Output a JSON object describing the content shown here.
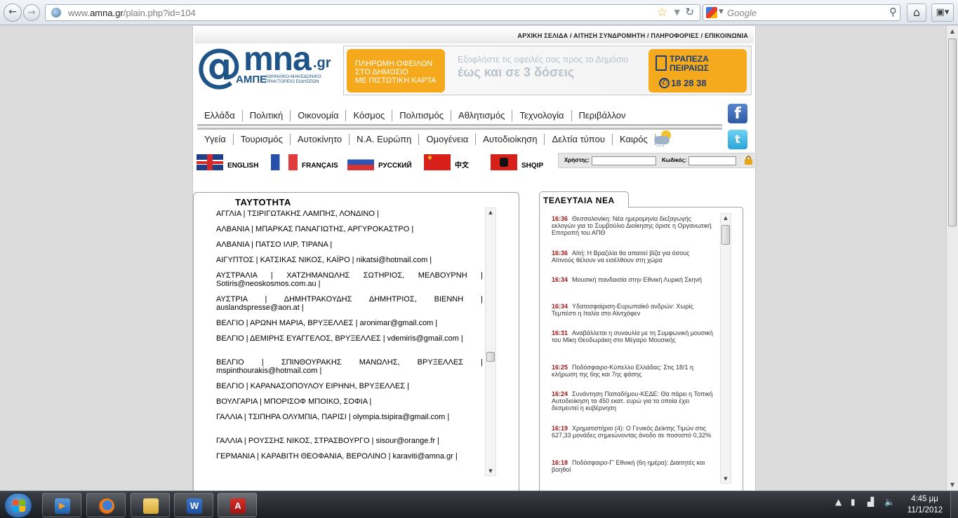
{
  "browser": {
    "url_prefix": "www.",
    "url_domain": "amna.gr",
    "url_path": "/plain.php?id=104",
    "search_placeholder": "Google"
  },
  "site": {
    "top_links": "ΑΡΧΙΚΗ ΣΕΛΙΔΑ / ΑΙΤΗΣΗ ΣΥΝΔΡΟΜΗΤΗ / ΠΛΗΡΟΦΟΡΙΕΣ / ΕΠΙΚΟΙΝΩΝΙΑ",
    "logo": {
      "at": "@",
      "name": "mna",
      "tld": ".gr",
      "acronym": "ΑΜΠΕ",
      "subtitle_1": "ΑΘΗΝΑΪΚΟ-ΜΑΚΕΔΟΝΙΚΟ",
      "subtitle_2": "ΠΡΑΚΤΟΡΕΙΟ ΕΙΔΗΣΕΩΝ"
    },
    "banner": {
      "left_line1": "ΠΛΗΡΩΜΗ ΟΦΕΙΛΩΝ",
      "left_line2": "ΣΤΟ ΔΗΜΟΣΙΟ",
      "left_line3": "ΜΕ ΠΙΣΤΩΤΙΚΗ ΚΑΡΤΑ",
      "mid_line1": "Εξοφλήστε τις οφειλές σας προς το Δημόσιο",
      "mid_line2": "έως και σε 3 δόσεις",
      "bank_line1": "ΤΡΑΠΕΖΑ",
      "bank_line2": "ΠΕΙΡΑΙΩΣ",
      "phone": "18 28 38"
    },
    "menu1": [
      "Ελλάδα",
      "Πολιτική",
      "Οικονομία",
      "Κόσμος",
      "Πολιτισμός",
      "Αθλητισμός",
      "Τεχνολογία",
      "Περιβάλλον"
    ],
    "menu2": [
      "Υγεία",
      "Τουρισμός",
      "Αυτοκίνητο",
      "Ν.Α. Ευρώπη",
      "Ομογένεια",
      "Αυτοδιοίκηση",
      "Δελτία τύπου",
      "Καιρός"
    ],
    "languages": [
      "ENGLISH",
      "FRANÇAIS",
      "РУССКИЙ",
      "中文",
      "SHQIP"
    ],
    "login": {
      "user_label": "Χρήστης:",
      "pass_label": "Κωδικός:"
    },
    "identity": {
      "title": "ΤΑΥΤΟΤΗΤΑ",
      "rows": [
        "ΑΓΓΛΙΑ | ΤΣΙΡΙΓΩΤΑΚΗΣ ΛΑΜΠΗΣ, ΛΟΝΔΙΝΟ |",
        "ΑΛΒΑΝΙΑ | ΜΠΑΡΚΑΣ ΠΑΝΑΓΙΩΤΗΣ, ΑΡΓΥΡΟΚΑΣΤΡΟ |",
        "ΑΛΒΑΝΙΑ | ΠΑΤΣΟ ΙΛΙΡ, ΤΙΡΑΝΑ |",
        "ΑΙΓΥΠΤΟΣ | ΚΑΤΣΙΚΑΣ ΝΙΚΟΣ, ΚΑΪΡΟ | nikatsi@hotmail.com |",
        "ΑΥΣΤΡΑΛΙΑ | ΧΑΤΖΗΜΑΝΩΛΗΣ ΣΩΤΗΡΙΟΣ, ΜΕΛΒΟΥΡΝΗ | Sotiris@neoskosmos.com.au |",
        "ΑΥΣΤΡΙΑ | ΔΗΜΗΤΡΑΚΟΥΔΗΣ ΔΗΜΗΤΡΙΟΣ, ΒΙΕΝΝΗ | auslandspresse@aon.at |",
        "ΒΕΛΓΙΟ | ΑΡΩΝΗ ΜΑΡΙΑ, ΒΡΥΞΕΛΛΕΣ | aronimar@gmail.com |",
        "ΒΕΛΓΙΟ | ΔΕΜΙΡΗΣ ΕΥΑΓΓΕΛΟΣ, ΒΡΥΞΕΛΛΕΣ | vdemiris@gmail.com |",
        "ΒΕΛΓΙΟ | ΣΠΙΝΘΟΥΡΑΚΗΣ ΜΑΝΩΛΗΣ, ΒΡΥΞΕΛΛΕΣ | mspinthourakis@hotmail.com |",
        "ΒΕΛΓΙΟ | ΚΑΡΑΝΑΣΟΠΟΥΛΟΥ ΕΙΡΗΝΗ, ΒΡΥΞΕΛΛΕΣ |",
        "ΒΟΥΛΓΑΡΙΑ | ΜΠΟΡΙΣΟΦ ΜΠΟΙΚΟ, ΣΟΦΙΑ |",
        "ΓΑΛΛΙΑ | ΤΣΙΠΗΡΑ ΟΛΥΜΠΙΑ, ΠΑΡΙΣΙ | olympia.tsipira@gmail.com |",
        "ΓΑΛΛΙΑ | ΡΟΥΣΣΗΣ ΝΙΚΟΣ, ΣΤΡΑΣΒΟΥΡΓΟ | sisour@orange.fr |",
        "ΓΕΡΜΑΝΙΑ | ΚΑΡΑΒΙΤΗ ΘΕΟΦΑΝΙΑ, ΒΕΡΟΛΙΝΟ | karaviti@amna.gr |"
      ]
    },
    "news": {
      "title": "ΤΕΛΕΥΤΑΙΑ ΝΕΑ",
      "items": [
        {
          "time": "16:36",
          "text": "Θεσσαλονίκη: Νέα ημερομηνία διεξαγωγής εκλογών για το Συμβούλιο Διοίκησης όρισε η Οργανωτική Επιτροπή του ΑΠΘ"
        },
        {
          "time": "16:36",
          "text": "Αϊτή: Η Βραζιλία θα απαιτεί βίζα για όσους Αϊτινούς θέλουν να εισέλθουν στη χώρα"
        },
        {
          "time": "16:34",
          "text": "Μουσική πανδαισία στην Εθνική Λυρική Σκηνή"
        },
        {
          "time": "16:34",
          "text": "Υδατοσφαίριση-Ευρωπαϊκό ανδρών: Χωρίς Τεμπέστι η Ιταλία στο Αϊντχόφεν"
        },
        {
          "time": "16:31",
          "text": "Αναβάλλεται η συναυλία με τη Συμφωνική μουσική του Μίκη Θεοδωράκη στο Μέγαρο Μουσικής"
        },
        {
          "time": "16:25",
          "text": "Ποδόσφαιρο-Κύπελλο Ελλάδας: Στις 18/1 η κλήρωση της 6ης και 7ης φάσης"
        },
        {
          "time": "16:24",
          "text": "Συνάντηση Παπαδήμου-ΚΕΔΕ: Θα πάρει η Τοπική Αυτοδιοίκηση τα 450 εκατ. ευρώ για τα οποία έχει δεσμευτεί η κυβέρνηση"
        },
        {
          "time": "16:19",
          "text": "Χρηματιστήριο (4): Ο Γενικός Δείκτης Τιμών στις 627,33 μονάδες σημειώνοντας άνοδο σε ποσοστό 0,32%"
        },
        {
          "time": "16:18",
          "text": "Ποδόσφαιρο-Γ' Εθνική (6η ημέρα): Διαιτητές και βοηθοί"
        }
      ]
    }
  },
  "taskbar": {
    "clock_time": "4:45 μμ",
    "clock_date": "11/1/2012",
    "word_glyph": "W",
    "acrobat_glyph": "A"
  }
}
